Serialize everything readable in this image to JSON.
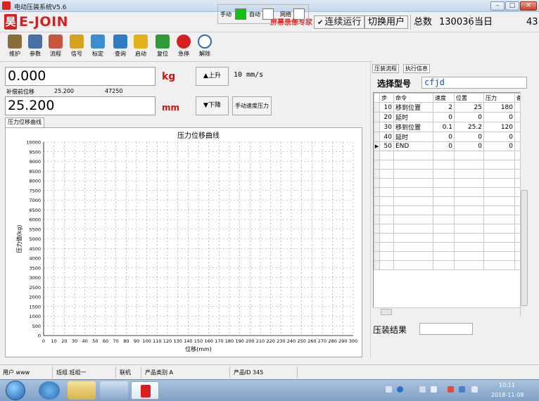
{
  "window": {
    "title": "电动压装系统V5.6"
  },
  "header": {
    "brand": "E-JOIN",
    "logo_glyph": "昊",
    "record_notice": "屏幕录像专家 未注册",
    "continuous_run": "连续运行",
    "switch_user": "切换用户",
    "total_label": "总数",
    "total_value": "130036",
    "today_label": "当日",
    "today_value": "43"
  },
  "toolbar": {
    "items": [
      {
        "label": "维护",
        "icon": "maintenance-icon",
        "color": "#8a6d3b"
      },
      {
        "label": "参数",
        "icon": "parameters-icon",
        "color": "#4a6fa5"
      },
      {
        "label": "流程",
        "icon": "process-icon",
        "color": "#c8553d"
      },
      {
        "label": "信号",
        "icon": "signal-icon",
        "color": "#d6a21e"
      },
      {
        "label": "标定",
        "icon": "calibrate-icon",
        "color": "#3b8fd1"
      },
      {
        "label": "查询",
        "icon": "query-icon",
        "color": "#2e7cc4"
      },
      {
        "label": "启动",
        "icon": "start-icon",
        "color": "#e3b21a"
      },
      {
        "label": "复位",
        "icon": "reset-icon",
        "color": "#2f9a3a"
      },
      {
        "label": "急停",
        "icon": "emergency-stop-icon",
        "color": "#d42020"
      },
      {
        "label": "解除",
        "icon": "release-icon",
        "color": "#2d6bb5"
      }
    ],
    "modes": {
      "manual_label": "手动",
      "manual_color": "#16c116",
      "auto_label": "自动",
      "network_label": "网络"
    }
  },
  "readouts": {
    "force_value": "0.000",
    "force_unit": "kg",
    "up_button": "▲上升",
    "speed": "10 mm/s",
    "compensation_label": "补偿前位移",
    "compensation_value": "25.200",
    "compensation_extra": "47250",
    "displacement_value": "25.200",
    "displacement_unit": "mm",
    "down_button": "▼下降",
    "manual_speed_button": "手动速度压力"
  },
  "chart_tab": "压力位移曲线",
  "chart_data": {
    "type": "line",
    "title": "压力位移曲线",
    "xlabel": "位移(mm)",
    "ylabel": "压力值(kg)",
    "xlim": [
      0,
      300
    ],
    "ylim": [
      0,
      10000
    ],
    "x_ticks": [
      0,
      10,
      20,
      30,
      40,
      50,
      60,
      70,
      80,
      90,
      100,
      110,
      120,
      130,
      140,
      150,
      160,
      170,
      180,
      190,
      200,
      210,
      220,
      230,
      240,
      250,
      260,
      270,
      280,
      290,
      300
    ],
    "y_ticks": [
      0,
      500,
      1000,
      1500,
      2000,
      2500,
      3000,
      3500,
      4000,
      4500,
      5000,
      5500,
      6000,
      6500,
      7000,
      7500,
      8000,
      8500,
      9000,
      9500,
      10000
    ],
    "grid": true,
    "series": []
  },
  "right_panel": {
    "tabs": [
      "压装流程",
      "执行信息"
    ],
    "model_label": "选择型号",
    "model_value": "cfjd",
    "columns": [
      "步",
      "命令",
      "速度",
      "位置",
      "压力",
      "备"
    ],
    "rows": [
      {
        "step": "10",
        "command": "移到位置",
        "speed": "2",
        "position": "25",
        "pressure": "180"
      },
      {
        "step": "20",
        "command": "延时",
        "speed": "0",
        "position": "0",
        "pressure": "0"
      },
      {
        "step": "30",
        "command": "移到位置",
        "speed": "0.1",
        "position": "25.2",
        "pressure": "120"
      },
      {
        "step": "40",
        "command": "延时",
        "speed": "0",
        "position": "0",
        "pressure": "0"
      },
      {
        "step": "50",
        "command": "END",
        "speed": "0",
        "position": "0",
        "pressure": "0"
      }
    ],
    "result_label": "压装结果"
  },
  "statusbar": {
    "user": "用户 www",
    "team": "班组 班组一",
    "mode": "联机",
    "product_type": "产品类别 A",
    "product_id": "产品ID 345"
  },
  "taskbar": {
    "time": "10:11",
    "date": "2018-11-08"
  }
}
